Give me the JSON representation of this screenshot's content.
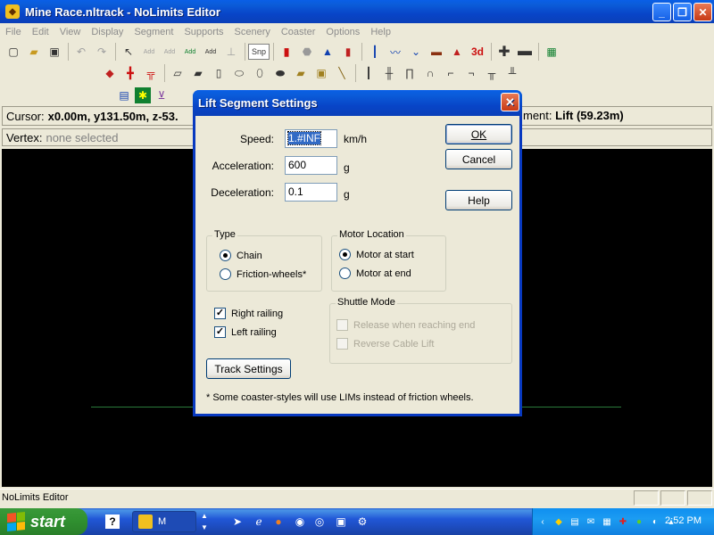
{
  "window": {
    "title": "Mine Race.nltrack - NoLimits Editor",
    "caption_buttons": {
      "minimize": "_",
      "maximize": "❐",
      "close": "✕"
    }
  },
  "menu": [
    "File",
    "Edit",
    "View",
    "Display",
    "Segment",
    "Supports",
    "Scenery",
    "Coaster",
    "Options",
    "Help"
  ],
  "toolbar": {
    "add1": "Add",
    "add2": "Add",
    "add3": "Add",
    "add4": "Add",
    "snap": "Snp",
    "view3d": "3d"
  },
  "cursor_bar": {
    "label": "Cursor:",
    "value": "x0.00m, y131.50m, z-53.",
    "segment_prefix": "ment:",
    "segment_value": "Lift (59.23m)"
  },
  "vertex_bar": {
    "label": "Vertex:",
    "value": "none selected"
  },
  "dialog": {
    "title": "Lift Segment Settings",
    "close": "✕",
    "speed": {
      "label": "Speed:",
      "value": "1.#INF",
      "unit": "km/h"
    },
    "acceleration": {
      "label": "Acceleration:",
      "value": "600",
      "unit": "g"
    },
    "deceleration": {
      "label": "Deceleration:",
      "value": "0.1",
      "unit": "g"
    },
    "ok_label": "OK",
    "cancel_label": "Cancel",
    "help_label": "Help",
    "type_group": {
      "legend": "Type",
      "options": [
        "Chain",
        "Friction-wheels*"
      ],
      "selected": "Chain"
    },
    "motor_group": {
      "legend": "Motor Location",
      "options": [
        "Motor at start",
        "Motor at end"
      ],
      "selected": "Motor at start"
    },
    "railing": {
      "right": {
        "label": "Right railing",
        "checked": true
      },
      "left": {
        "label": "Left railing",
        "checked": true
      }
    },
    "shuttle_group": {
      "legend": "Shuttle Mode",
      "options": [
        "Release when reaching end",
        "Reverse Cable Lift"
      ]
    },
    "track_settings_label": "Track Settings",
    "note": "* Some coaster-styles will use LIMs instead of friction wheels."
  },
  "status_bar": {
    "text": "NoLimits Editor"
  },
  "taskbar": {
    "start_label": "start",
    "task_label": "M",
    "clock": "2:52 PM"
  },
  "colors": {
    "titlebar": "#0845c8",
    "viewport": "#000000",
    "ground_line": "#2a7a3a",
    "dialog_bg": "#ece9d8"
  }
}
